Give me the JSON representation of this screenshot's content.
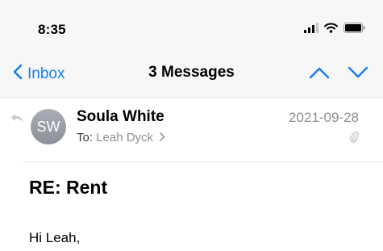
{
  "status_bar": {
    "time": "8:35",
    "icons": [
      "signal-icon",
      "wifi-icon",
      "battery-icon"
    ]
  },
  "nav": {
    "back_label": "Inbox",
    "title": "3 Messages",
    "icons": [
      "chevron-left-icon",
      "chevron-up-icon",
      "chevron-down-icon"
    ]
  },
  "message": {
    "avatar_initials": "SW",
    "sender": "Soula White",
    "date": "2021-09-28",
    "to_label": "To:",
    "recipient": "Leah Dyck",
    "subject": "RE: Rent",
    "body_greeting": "Hi Leah,",
    "icons": [
      "reply-icon",
      "paperclip-icon",
      "chevron-right-icon"
    ]
  },
  "colors": {
    "accent": "#1a7cf5",
    "secondary_text": "#8e8e93",
    "header_bg": "#f7f7f7"
  }
}
